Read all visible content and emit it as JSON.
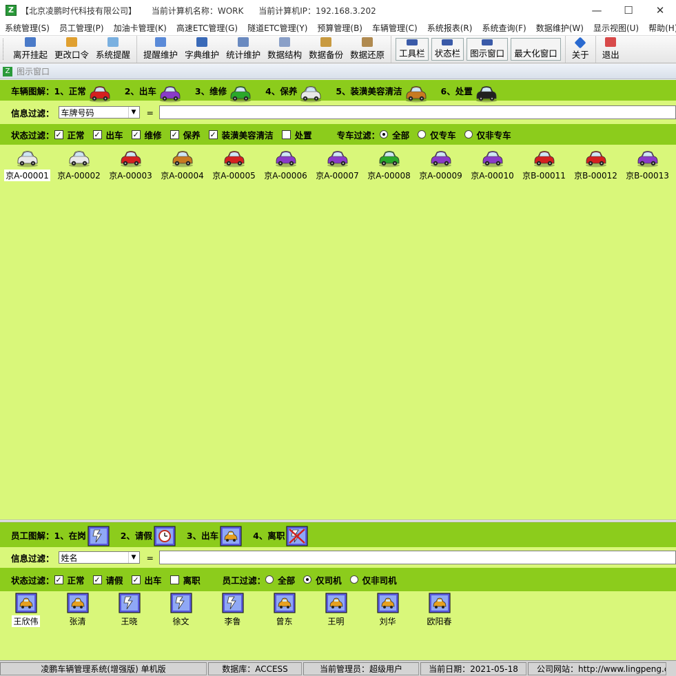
{
  "titlebar": {
    "company": "【北京凌鹏时代科技有限公司】",
    "computer_name": "当前计算机名称：WORK",
    "computer_ip": "当前计算机IP：192.168.3.202"
  },
  "menu": [
    "系统管理(S)",
    "员工管理(P)",
    "加油卡管理(K)",
    "高速ETC管理(G)",
    "隧道ETC管理(Y)",
    "预算管理(B)",
    "车辆管理(C)",
    "系统报表(R)",
    "系统查询(F)",
    "数据维护(W)",
    "显示视图(U)",
    "帮助(H)"
  ],
  "toolbar": {
    "group1": [
      "离开挂起",
      "更改口令",
      "系统提醒"
    ],
    "group2": [
      "提醒维护",
      "字典维护",
      "统计维护",
      "数据结构",
      "数据备份",
      "数据还原"
    ],
    "group3": [
      "工具栏",
      "状态栏",
      "图示窗口",
      "最大化窗口"
    ],
    "group4": [
      "关于"
    ],
    "group5": [
      "退出"
    ]
  },
  "subwindow_title": "图示窗口",
  "vehicle_panel": {
    "legend_title": "车辆图解：",
    "legend": [
      {
        "label": "1、正常",
        "color": "#d42020"
      },
      {
        "label": "2、出车",
        "color": "#8a3bc8"
      },
      {
        "label": "3、维修",
        "color": "#2aa82a"
      },
      {
        "label": "4、保养",
        "color": "#e8e8e8"
      },
      {
        "label": "5、装潢美容清洁",
        "color": "#c87a20"
      },
      {
        "label": "6、处置",
        "color": "#202020"
      }
    ],
    "filter_label": "信息过滤：",
    "filter_field": "车牌号码",
    "equals": "=",
    "filter_value": "",
    "status_label": "状态过滤：",
    "status_filters": [
      {
        "label": "正常",
        "checked": true
      },
      {
        "label": "出车",
        "checked": true
      },
      {
        "label": "维修",
        "checked": true
      },
      {
        "label": "保养",
        "checked": true
      },
      {
        "label": "装潢美容清洁",
        "checked": true
      },
      {
        "label": "处置",
        "checked": false
      }
    ],
    "special_label": "专车过滤：",
    "special_filters": [
      {
        "label": "全部",
        "selected": true
      },
      {
        "label": "仅专车",
        "selected": false
      },
      {
        "label": "仅非专车",
        "selected": false
      }
    ],
    "vehicles": [
      {
        "plate": "京A-00001",
        "color": "#e8e8e8",
        "selected": true
      },
      {
        "plate": "京A-00002",
        "color": "#e8e8e8",
        "selected": false
      },
      {
        "plate": "京A-00003",
        "color": "#d42020",
        "selected": false
      },
      {
        "plate": "京A-00004",
        "color": "#c87a20",
        "selected": false
      },
      {
        "plate": "京A-00005",
        "color": "#d42020",
        "selected": false
      },
      {
        "plate": "京A-00006",
        "color": "#8a3bc8",
        "selected": false
      },
      {
        "plate": "京A-00007",
        "color": "#8a3bc8",
        "selected": false
      },
      {
        "plate": "京A-00008",
        "color": "#2aa82a",
        "selected": false
      },
      {
        "plate": "京A-00009",
        "color": "#8a3bc8",
        "selected": false
      },
      {
        "plate": "京A-00010",
        "color": "#8a3bc8",
        "selected": false
      },
      {
        "plate": "京B-00011",
        "color": "#d42020",
        "selected": false
      },
      {
        "plate": "京B-00012",
        "color": "#d42020",
        "selected": false
      },
      {
        "plate": "京B-00013",
        "color": "#8a3bc8",
        "selected": false
      }
    ]
  },
  "staff_panel": {
    "legend_title": "员工图解：",
    "legend": [
      {
        "label": "1、在岗",
        "icon": "on-duty-icon"
      },
      {
        "label": "2、请假",
        "icon": "leave-clock-icon"
      },
      {
        "label": "3、出车",
        "icon": "driving-taxi-icon"
      },
      {
        "label": "4、离职",
        "icon": "resigned-icon"
      }
    ],
    "filter_label": "信息过滤：",
    "filter_field": "姓名",
    "equals": "=",
    "filter_value": "",
    "status_label": "状态过滤：",
    "status_filters": [
      {
        "label": "正常",
        "checked": true
      },
      {
        "label": "请假",
        "checked": true
      },
      {
        "label": "出车",
        "checked": true
      },
      {
        "label": "离职",
        "checked": false
      }
    ],
    "staff_filter_label": "员工过滤：",
    "staff_filters": [
      {
        "label": "全部",
        "selected": false
      },
      {
        "label": "仅司机",
        "selected": true
      },
      {
        "label": "仅非司机",
        "selected": false
      }
    ],
    "staff": [
      {
        "name": "王欣伟",
        "state": "driving",
        "selected": true
      },
      {
        "name": "张清",
        "state": "driving",
        "selected": false
      },
      {
        "name": "王晓",
        "state": "on-duty",
        "selected": false
      },
      {
        "name": "徐文",
        "state": "on-duty",
        "selected": false
      },
      {
        "name": "李鲁",
        "state": "on-duty",
        "selected": false
      },
      {
        "name": "曾东",
        "state": "driving",
        "selected": false
      },
      {
        "name": "王明",
        "state": "driving",
        "selected": false
      },
      {
        "name": "刘华",
        "state": "driving",
        "selected": false
      },
      {
        "name": "欧阳春",
        "state": "driving",
        "selected": false
      }
    ]
  },
  "statusbar": {
    "product": "凌鹏车辆管理系统(增强版) 单机版",
    "database": "数据库：ACCESS",
    "admin": "当前管理员：超级用户",
    "date": "当前日期：2021-05-18",
    "website": "公司网站：http://www.lingpeng.c"
  }
}
